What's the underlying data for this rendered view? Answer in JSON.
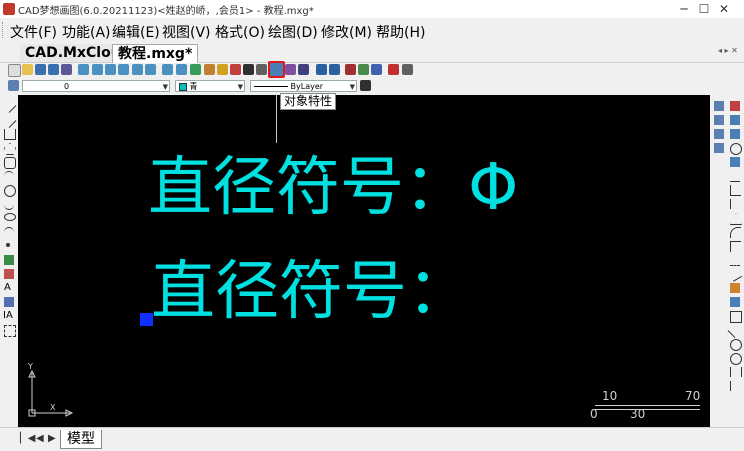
{
  "window": {
    "title": "CAD梦想画图(6.0.20211123)<姓赵的峤，,会员1> - 教程.mxg*",
    "minimize": "─",
    "maximize": "☐",
    "close": "✕"
  },
  "menu": [
    "文件(F)",
    "功能(A)",
    "编辑(E)",
    "视图(V)",
    "格式(O)",
    "绘图(D)",
    "修改(M)",
    "帮助(H)"
  ],
  "tabs": {
    "inactive": "CAD.MxCloud",
    "active": "教程.mxg*",
    "scroll_glyphs": "◂ ▸ ✕"
  },
  "toolbar": {
    "highlighted_tool": "object-properties",
    "tooltip": "对象特性"
  },
  "layerbar": {
    "layer_value": "0",
    "color_value": "青",
    "linetype_value": "ByLayer"
  },
  "drawing": {
    "line1": "直径符号：Φ",
    "line2": "直径符号：",
    "text_color": "#00e0e0"
  },
  "ucs": {
    "x_label": "X",
    "y_label": "Y"
  },
  "scalebar": {
    "top_left": "10",
    "top_right": "70",
    "bottom_left": "0",
    "bottom_mid": "30"
  },
  "statusbar": {
    "model_tab": "模型"
  }
}
